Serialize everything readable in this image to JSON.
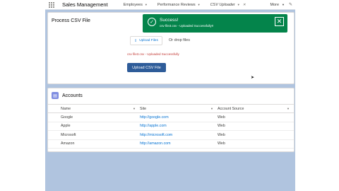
{
  "navbar": {
    "app_name": "Sales Management",
    "items": [
      {
        "label": "Employees"
      },
      {
        "label": "Performance Reviews"
      },
      {
        "label": "CSV Uploader"
      }
    ],
    "more_label": "More"
  },
  "upload_card": {
    "title": "Process CSV File",
    "upload_button": "Upload Files",
    "drop_text": "Or drop files",
    "file_status": "csv file3.csv - Uploaded Successfully",
    "submit_button": "Upload CSV File"
  },
  "toast": {
    "title": "Success!",
    "message": "csv file3.csv - Uploaded Successfully!!"
  },
  "accounts": {
    "title": "Accounts",
    "columns": [
      "Name",
      "Site",
      "Account Source"
    ],
    "rows": [
      {
        "name": "Google",
        "site": "http://google.com",
        "source": "Web"
      },
      {
        "name": "Apple",
        "site": "http://apple.com",
        "source": "Web"
      },
      {
        "name": "Microsoft",
        "site": "http://microsoft.com",
        "source": "Web"
      },
      {
        "name": "Amazon",
        "site": "http://amazon.com",
        "source": "Web"
      }
    ]
  },
  "colors": {
    "toast": "#04844b",
    "brand_button": "#2e5c99",
    "link": "#0070d2",
    "background": "#b0c4df"
  },
  "icons": [
    "app-launcher-icon",
    "upload-icon",
    "success-check-icon",
    "close-icon",
    "accounts-icon",
    "edit-pencil-icon"
  ]
}
